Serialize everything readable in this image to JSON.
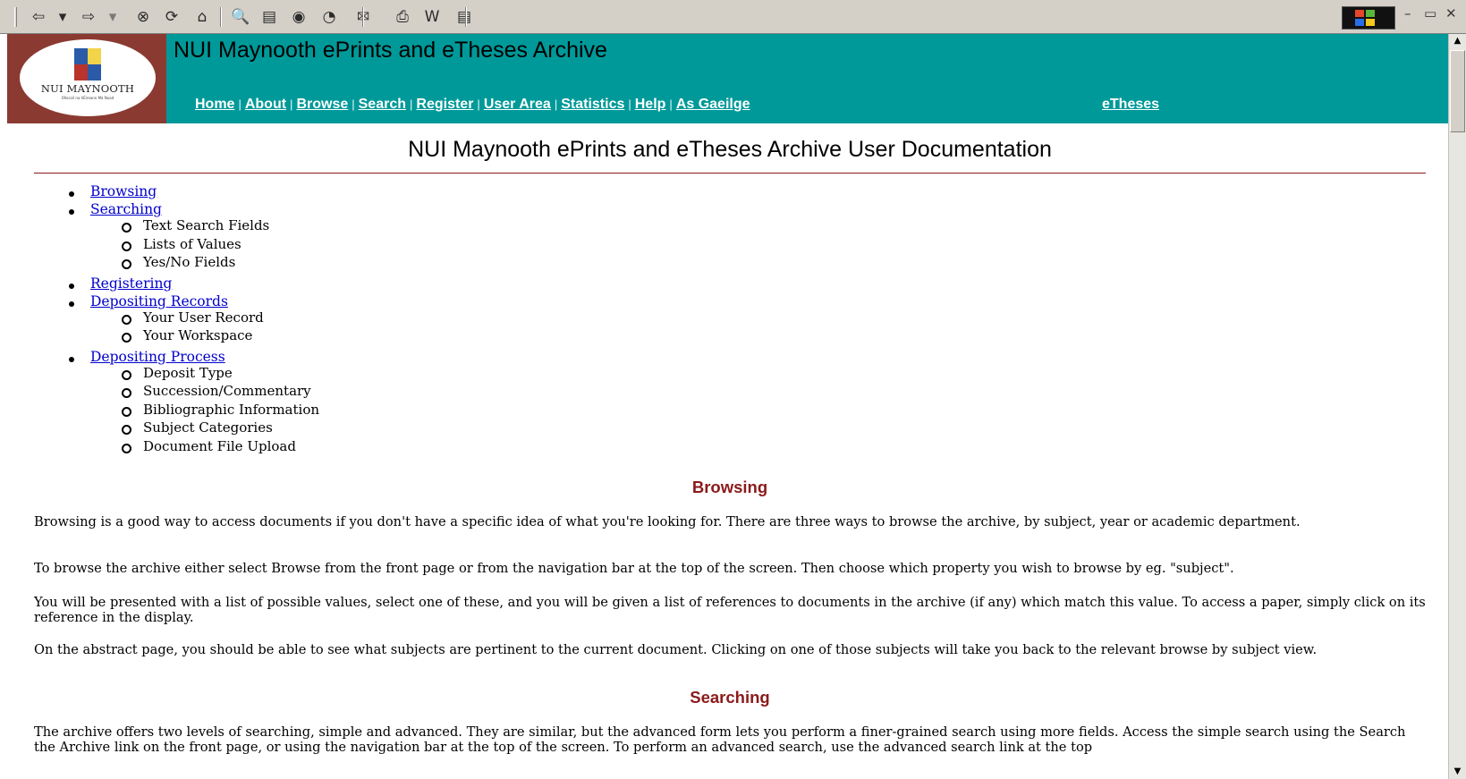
{
  "toolbar": {
    "buttons": [
      {
        "name": "back-icon",
        "glyph": "⇦"
      },
      {
        "name": "back-dropdown-icon",
        "glyph": "▾"
      },
      {
        "name": "forward-icon",
        "glyph": "⇨"
      },
      {
        "name": "forward-dropdown-icon",
        "glyph": "▾"
      },
      {
        "name": "stop-icon",
        "glyph": "⊗"
      },
      {
        "name": "refresh-icon",
        "glyph": "⟳"
      },
      {
        "name": "home-icon",
        "glyph": "⌂"
      },
      {
        "name": "search-icon",
        "glyph": "🔍"
      },
      {
        "name": "favorites-icon",
        "glyph": "▤"
      },
      {
        "name": "media-icon",
        "glyph": "◉"
      },
      {
        "name": "history-icon",
        "glyph": "◔"
      },
      {
        "name": "mail-icon",
        "glyph": "✉"
      },
      {
        "name": "print-icon",
        "glyph": "⎙"
      },
      {
        "name": "edit-icon",
        "glyph": "W"
      },
      {
        "name": "discuss-icon",
        "glyph": "▤"
      }
    ],
    "window_controls": {
      "minimize": "–",
      "restore": "▭",
      "close": "✕"
    }
  },
  "site": {
    "logo_text": "NUI MAYNOOTH",
    "logo_subtext": "Ollscoil na hÉireann Má Nuad",
    "title": "NUI Maynooth ePrints and eTheses Archive",
    "nav": [
      "Home",
      "About",
      "Browse",
      "Search",
      "Register",
      "User Area",
      "Statistics",
      "Help",
      "As Gaeilge"
    ],
    "nav_separator": "|",
    "nav_right": "eTheses"
  },
  "doc": {
    "title": "NUI Maynooth ePrints and eTheses Archive User Documentation",
    "toc": [
      {
        "label": "Browsing",
        "children": []
      },
      {
        "label": "Searching",
        "children": [
          "Text Search Fields",
          "Lists of Values",
          "Yes/No Fields"
        ]
      },
      {
        "label": "Registering",
        "children": []
      },
      {
        "label": "Depositing Records",
        "children": [
          "Your User Record",
          "Your Workspace"
        ]
      },
      {
        "label": "Depositing Process",
        "children": [
          "Deposit Type",
          "Succession/Commentary",
          "Bibliographic Information",
          "Subject Categories",
          "Document File Upload"
        ]
      }
    ],
    "browsing": {
      "heading": "Browsing",
      "paragraphs": [
        "Browsing is a good way to access documents if you don't have a specific idea of what you're looking for. There are three ways to browse the archive, by subject, year or academic department.",
        "To browse the archive either select Browse from the front page or from the navigation bar at the top of the screen. Then choose which property you wish to browse by eg. \"subject\".",
        "You will be presented with a list of possible values, select one of these, and you will be given a list of references to documents in the archive (if any) which match this value. To access a paper, simply click on its reference in the display.",
        "On the abstract page, you should be able to see what subjects are pertinent to the current document. Clicking on one of those subjects will take you back to the relevant browse by subject view."
      ]
    },
    "searching": {
      "heading": "Searching",
      "paragraphs": [
        "The archive offers two levels of searching, simple and advanced. They are similar, but the advanced form lets you perform a finer-grained search using more fields. Access the simple search using the Search the Archive link on the front page, or using the navigation bar at the top of the screen. To perform an advanced search, use the advanced search link at the top"
      ]
    }
  },
  "colors": {
    "banner": "#009999",
    "logo_background": "#8b3a32",
    "heading": "#8b1a1a",
    "link": "#0000cc"
  }
}
